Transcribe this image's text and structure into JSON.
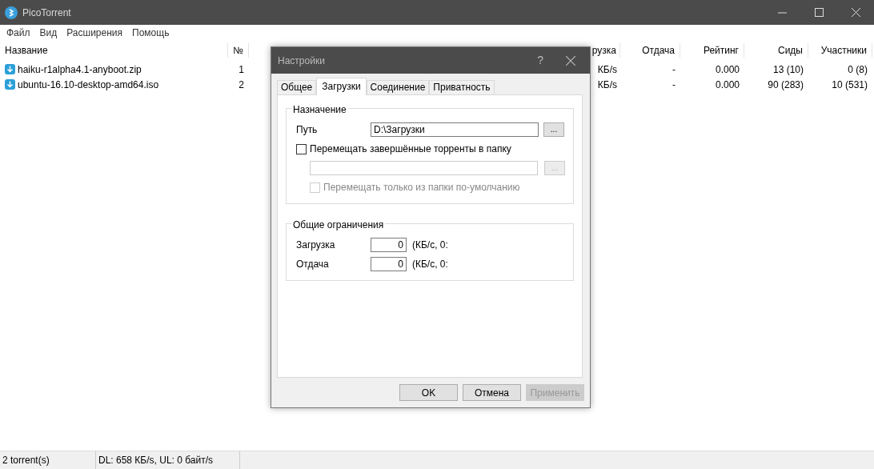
{
  "window": {
    "title": "PicoTorrent"
  },
  "menu": [
    "Файл",
    "Вид",
    "Расширения",
    "Помощь"
  ],
  "table": {
    "columns": [
      {
        "label": "Название"
      },
      {
        "label": "№"
      },
      {
        "label": "рузка"
      },
      {
        "label": "Отдача"
      },
      {
        "label": "Рейтинг"
      },
      {
        "label": "Сиды"
      },
      {
        "label": "Участники"
      }
    ],
    "rows": [
      {
        "cells": [
          "haiku-r1alpha4.1-anyboot.zip",
          "1",
          "КБ/s",
          "-",
          "0.000",
          "13 (10)",
          "0 (8)"
        ]
      },
      {
        "cells": [
          "ubuntu-16.10-desktop-amd64.iso",
          "2",
          "КБ/s",
          "-",
          "0.000",
          "90 (283)",
          "10 (531)"
        ]
      }
    ]
  },
  "dialog": {
    "title": "Настройки",
    "help": "?",
    "tabs": [
      {
        "label": "Общее",
        "selected": false
      },
      {
        "label": "Загрузки",
        "selected": true
      },
      {
        "label": "Соединение",
        "selected": false
      },
      {
        "label": "Приватность",
        "selected": false
      }
    ],
    "destination": {
      "legend": "Назначение",
      "path_label": "Путь",
      "path": "D:\\Загрузки",
      "browse": "...",
      "move_checkbox": {
        "label": "Перемещать завершённые торренты в папку",
        "checked": false
      },
      "move_browse": "...",
      "move_browse_disabled": true,
      "only_default": {
        "label": "Перемещать только из папки по-умолчанию",
        "checked": false,
        "disabled": true
      }
    },
    "limits": {
      "legend": "Общие ограничения",
      "rows": [
        {
          "label": "Загрузка",
          "value": "0",
          "hint": "(КБ/с, 0:"
        },
        {
          "label": "Отдача",
          "value": "0",
          "hint": "(КБ/с, 0:"
        }
      ]
    },
    "buttons": [
      {
        "label": "OK",
        "disabled": false
      },
      {
        "label": "Отмена",
        "disabled": false
      },
      {
        "label": "Применить",
        "disabled": true
      }
    ]
  },
  "status_bar": [
    "2 torrent(s)",
    "DL: 658 КБ/s, UL: 0 байт/s"
  ]
}
